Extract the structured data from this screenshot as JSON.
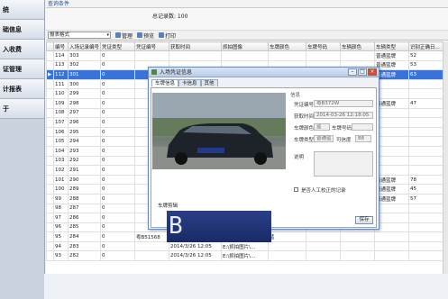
{
  "sidebar": {
    "items": [
      {
        "label": "统"
      },
      {
        "label": "础信息"
      },
      {
        "label": "入收费"
      },
      {
        "label": "证管理"
      },
      {
        "label": "计报表"
      },
      {
        "label": "于"
      }
    ]
  },
  "top": {
    "label": "查询条件"
  },
  "filter": {
    "count_label": "总记录数: 100"
  },
  "toolbar": {
    "select_value": "报表格式",
    "manage_label": "管理",
    "preview_label": "预览",
    "print_label": "打印"
  },
  "grid": {
    "columns": [
      "编号",
      "入场记录编号",
      "凭证类型",
      "凭证编号",
      "获取时间",
      "抓拍图像",
      "车牌颜色",
      "车牌号码",
      "车辆颜色",
      "车辆类型",
      "识别正确日..."
    ],
    "rows": [
      [
        "114",
        "303",
        "0",
        "",
        "",
        "",
        "",
        "",
        "",
        "普通蓝牌",
        "52"
      ],
      [
        "113",
        "302",
        "0",
        "",
        "",
        "",
        "",
        "",
        "",
        "普通蓝牌",
        "53"
      ],
      [
        "112",
        "301",
        "0",
        "",
        "",
        "",
        "",
        "",
        "",
        "普通蓝牌",
        "63"
      ],
      [
        "111",
        "300",
        "0",
        "",
        "",
        "",
        "",
        "",
        "",
        "",
        ""
      ],
      [
        "110",
        "299",
        "0",
        "",
        "",
        "",
        "",
        "",
        "",
        "",
        ""
      ],
      [
        "109",
        "298",
        "0",
        "",
        "",
        "",
        "",
        "",
        "",
        "普通蓝牌",
        "47"
      ],
      [
        "108",
        "297",
        "0",
        "",
        "",
        "",
        "",
        "",
        "",
        "",
        ""
      ],
      [
        "107",
        "296",
        "0",
        "",
        "",
        "",
        "",
        "",
        "",
        "",
        ""
      ],
      [
        "106",
        "295",
        "0",
        "",
        "",
        "",
        "",
        "",
        "",
        "",
        ""
      ],
      [
        "105",
        "294",
        "0",
        "",
        "",
        "",
        "",
        "",
        "",
        "",
        ""
      ],
      [
        "104",
        "293",
        "0",
        "",
        "",
        "",
        "",
        "",
        "",
        "",
        ""
      ],
      [
        "103",
        "292",
        "0",
        "",
        "",
        "",
        "",
        "",
        "",
        "",
        ""
      ],
      [
        "102",
        "291",
        "0",
        "",
        "",
        "",
        "",
        "",
        "",
        "",
        ""
      ],
      [
        "101",
        "290",
        "0",
        "",
        "",
        "",
        "",
        "",
        "",
        "普通蓝牌",
        "78"
      ],
      [
        "100",
        "289",
        "0",
        "",
        "",
        "",
        "",
        "",
        "",
        "普通蓝牌",
        "45"
      ],
      [
        "99",
        "288",
        "0",
        "",
        "",
        "",
        "",
        "",
        "",
        "普通蓝牌",
        "57"
      ],
      [
        "98",
        "287",
        "0",
        "",
        "",
        "",
        "",
        "",
        "",
        "",
        ""
      ],
      [
        "97",
        "286",
        "0",
        "",
        "",
        "",
        "",
        "",
        "",
        "",
        ""
      ],
      [
        "96",
        "285",
        "0",
        "",
        "",
        "",
        "",
        "",
        "",
        "",
        ""
      ],
      [
        "95",
        "284",
        "0",
        "粤B51568",
        "2014/3/26 12:05",
        "E:\\抓拍图片\\...",
        "蓝",
        "",
        "",
        "",
        ""
      ],
      [
        "94",
        "283",
        "0",
        "",
        "2014/3/26 12:05",
        "E:\\抓拍图片\\...",
        "",
        "",
        "",
        "",
        ""
      ],
      [
        "93",
        "282",
        "0",
        "",
        "2014/3/26 12:05",
        "E:\\抓拍图片\\...",
        "",
        "",
        "",
        "",
        ""
      ]
    ],
    "selected_row": 2
  },
  "dialog": {
    "title": "入场凭证信息",
    "tabs": [
      "车牌信息",
      "卡信息",
      "其他"
    ],
    "info_heading": "信息",
    "fields": {
      "voucher_no_label": "凭证编号",
      "voucher_no": "粤B372W",
      "time_label": "获取时间",
      "time": "2014-03-26 12:18:05",
      "plate_color_label": "车牌颜色",
      "plate_color": "蓝",
      "plate_no_label": "车牌号码",
      "plate_no": "",
      "vehicle_type_label": "车牌类型",
      "vehicle_type": "普通蓝",
      "confidence_label": "可信度",
      "confidence": "88",
      "note_label": "说明"
    },
    "manual_check_label": "是否人工校正的记录",
    "plate_section_label": "车牌剪辑",
    "plate_text": "B B372W",
    "save_label": "保存"
  }
}
